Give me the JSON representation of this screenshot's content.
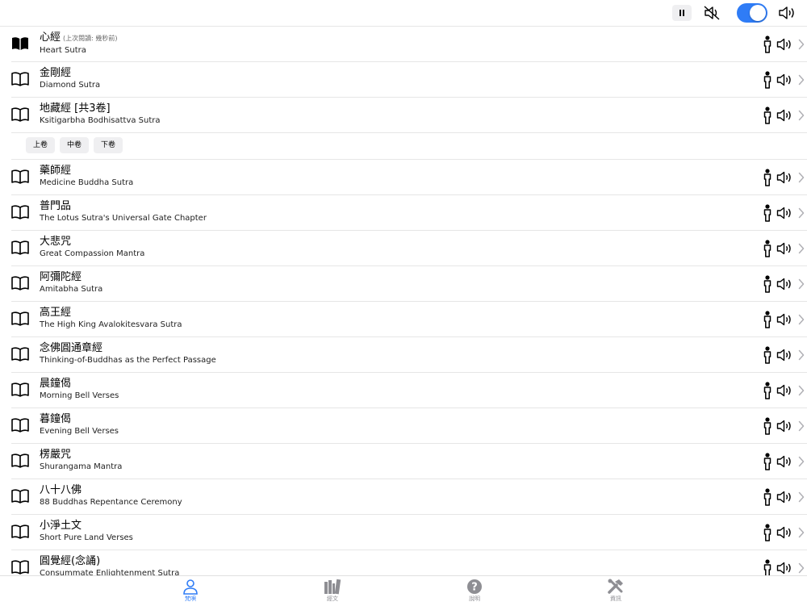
{
  "player": {
    "pause_icon": "pause-icon",
    "mute_icon": "speaker-muted-icon",
    "toggle_on": true,
    "volume_icon": "speaker-volume-icon",
    "accent": "#2f7cf6"
  },
  "sutras": [
    {
      "cn": "心經",
      "note": "(上次閱讀: 幾秒前)",
      "en": "Heart Sutra",
      "icon": "book-filled-icon"
    },
    {
      "cn": "金剛經",
      "en": "Diamond Sutra",
      "icon": "book-open-icon"
    },
    {
      "cn": "地藏經 [共3卷]",
      "en": "Ksitigarbha Bodhisattva Sutra",
      "icon": "book-open-icon",
      "volumes": [
        "上卷",
        "中卷",
        "下卷"
      ]
    },
    {
      "cn": "藥師經",
      "en": "Medicine Buddha Sutra",
      "icon": "book-open-icon"
    },
    {
      "cn": "普門品",
      "en": "The Lotus Sutra's Universal Gate Chapter",
      "icon": "book-open-icon"
    },
    {
      "cn": "大悲咒",
      "en": "Great Compassion Mantra",
      "icon": "book-open-icon"
    },
    {
      "cn": "阿彌陀經",
      "en": "Amitabha Sutra",
      "icon": "book-open-icon"
    },
    {
      "cn": "高王經",
      "en": "The High King Avalokitesvara Sutra",
      "icon": "book-open-icon"
    },
    {
      "cn": "念佛圓通章經",
      "en": "Thinking-of-Buddhas as the Perfect Passage",
      "icon": "book-open-icon"
    },
    {
      "cn": "晨鐘偈",
      "en": "Morning Bell Verses",
      "icon": "book-open-icon"
    },
    {
      "cn": "暮鐘偈",
      "en": "Evening Bell Verses",
      "icon": "book-open-icon"
    },
    {
      "cn": "楞嚴咒",
      "en": "Shurangama Mantra",
      "icon": "book-open-icon"
    },
    {
      "cn": "八十八佛",
      "en": "88 Buddhas Repentance Ceremony",
      "icon": "book-open-icon"
    },
    {
      "cn": "小淨土文",
      "en": "Short Pure Land Verses",
      "icon": "book-open-icon"
    },
    {
      "cn": "圓覺經(念誦)",
      "en": "Consummate Enlightenment Sutra",
      "icon": "book-open-icon"
    }
  ],
  "row_icons": {
    "person": "person-icon",
    "speaker": "speaker-icon",
    "chevron": "chevron-right-icon"
  },
  "tabs": [
    {
      "label": "梵唄",
      "icon": "person-icon",
      "active": true
    },
    {
      "label": "經文",
      "icon": "books-icon",
      "active": false
    },
    {
      "label": "說明",
      "icon": "help-icon",
      "active": false
    },
    {
      "label": "資訊",
      "icon": "tools-icon",
      "active": false
    }
  ]
}
